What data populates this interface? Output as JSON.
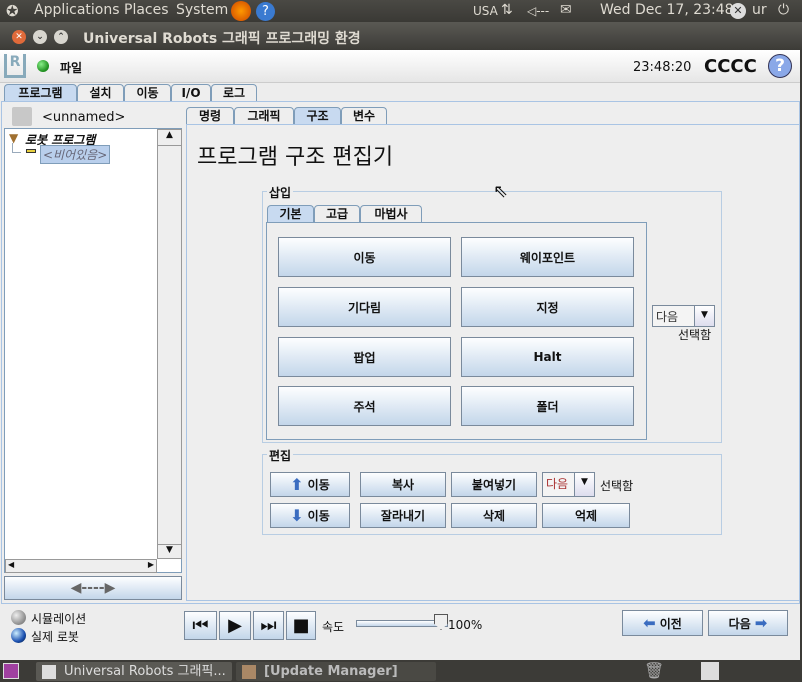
{
  "top_panel": {
    "menus": [
      "Applications",
      "Places",
      "System"
    ],
    "keyboard": "USA",
    "volume": "◁---",
    "clock": "Wed Dec 17, 23:48",
    "user": "ur"
  },
  "window": {
    "title": "Universal Robots 그래픽 프로그래밍 환경"
  },
  "header": {
    "menu_file": "파일",
    "time": "23:48:20",
    "robot_name": "CCCC",
    "help": "?"
  },
  "main_tabs": [
    {
      "label": "프로그램",
      "selected": true
    },
    {
      "label": "설치"
    },
    {
      "label": "이동"
    },
    {
      "label": "I/O"
    },
    {
      "label": "로그"
    }
  ],
  "left": {
    "filename": "<unnamed>",
    "tree": {
      "root": "로봇 프로그램",
      "child": "<비어있음>"
    }
  },
  "sub_tabs": [
    {
      "label": "명령"
    },
    {
      "label": "그래픽"
    },
    {
      "label": "구조",
      "selected": true
    },
    {
      "label": "변수"
    }
  ],
  "editor": {
    "title": "프로그램 구조 편집기",
    "insert": {
      "label": "삽입",
      "tabs": [
        {
          "label": "기본",
          "selected": true
        },
        {
          "label": "고급"
        },
        {
          "label": "마법사"
        }
      ],
      "buttons": [
        "이동",
        "웨이포인트",
        "기다림",
        "지정",
        "팝업",
        "Halt",
        "주석",
        "폴더"
      ],
      "combo_value": "다음",
      "combo_label": "선택함"
    },
    "edit": {
      "label": "편집",
      "move_up": "이동",
      "move_down": "이동",
      "copy": "복사",
      "paste": "붙여넣기",
      "cut": "잘라내기",
      "delete": "삭제",
      "suppress": "억제",
      "combo_value": "다음",
      "combo_label": "선택함"
    }
  },
  "bottom": {
    "simulation": "시뮬레이션",
    "real_robot": "실제 로봇",
    "mode_selected": "실제 로봇",
    "speed_label": "속도",
    "speed_value": "100%",
    "speed_level": 100,
    "prev": "이전",
    "next": "다음"
  },
  "taskbar": {
    "items": [
      "Universal Robots 그래픽...",
      "[Update Manager]"
    ]
  },
  "colors": {
    "accent": "#c8daf0",
    "border": "#7f9db9",
    "led_green": "#2a9a2a"
  }
}
